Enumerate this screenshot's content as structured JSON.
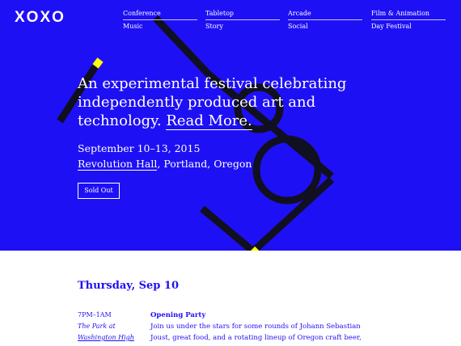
{
  "colors": {
    "brand_blue": "#1e10f5",
    "accent_yellow": "#ffff00",
    "text_white": "#ffffff"
  },
  "header": {
    "logo": "XOXO",
    "nav_top": [
      "Conference",
      "Tabletop",
      "Arcade",
      "Film & Animation"
    ],
    "nav_bottom": [
      "Music",
      "Story",
      "Social",
      "Day Festival"
    ]
  },
  "hero": {
    "headline": "An experimental festival celebrating independently produced art and technology.",
    "read_more": "Read More.",
    "dates": "September 10–13, 2015",
    "venue_link": "Revolution Hall",
    "venue_location": ", Portland, Oregon",
    "cta": "Sold Out"
  },
  "schedule": {
    "day_title": "Thursday, Sep 10",
    "events": [
      {
        "time": "7PM–1AM",
        "venue_line1": "The Park at",
        "venue_line2": "Washington High",
        "title": "Opening Party",
        "description": "Join us under the stars for some rounds of Johann Sebastian Joust, great food, and a rotating lineup of Oregon craft beer,"
      }
    ]
  }
}
